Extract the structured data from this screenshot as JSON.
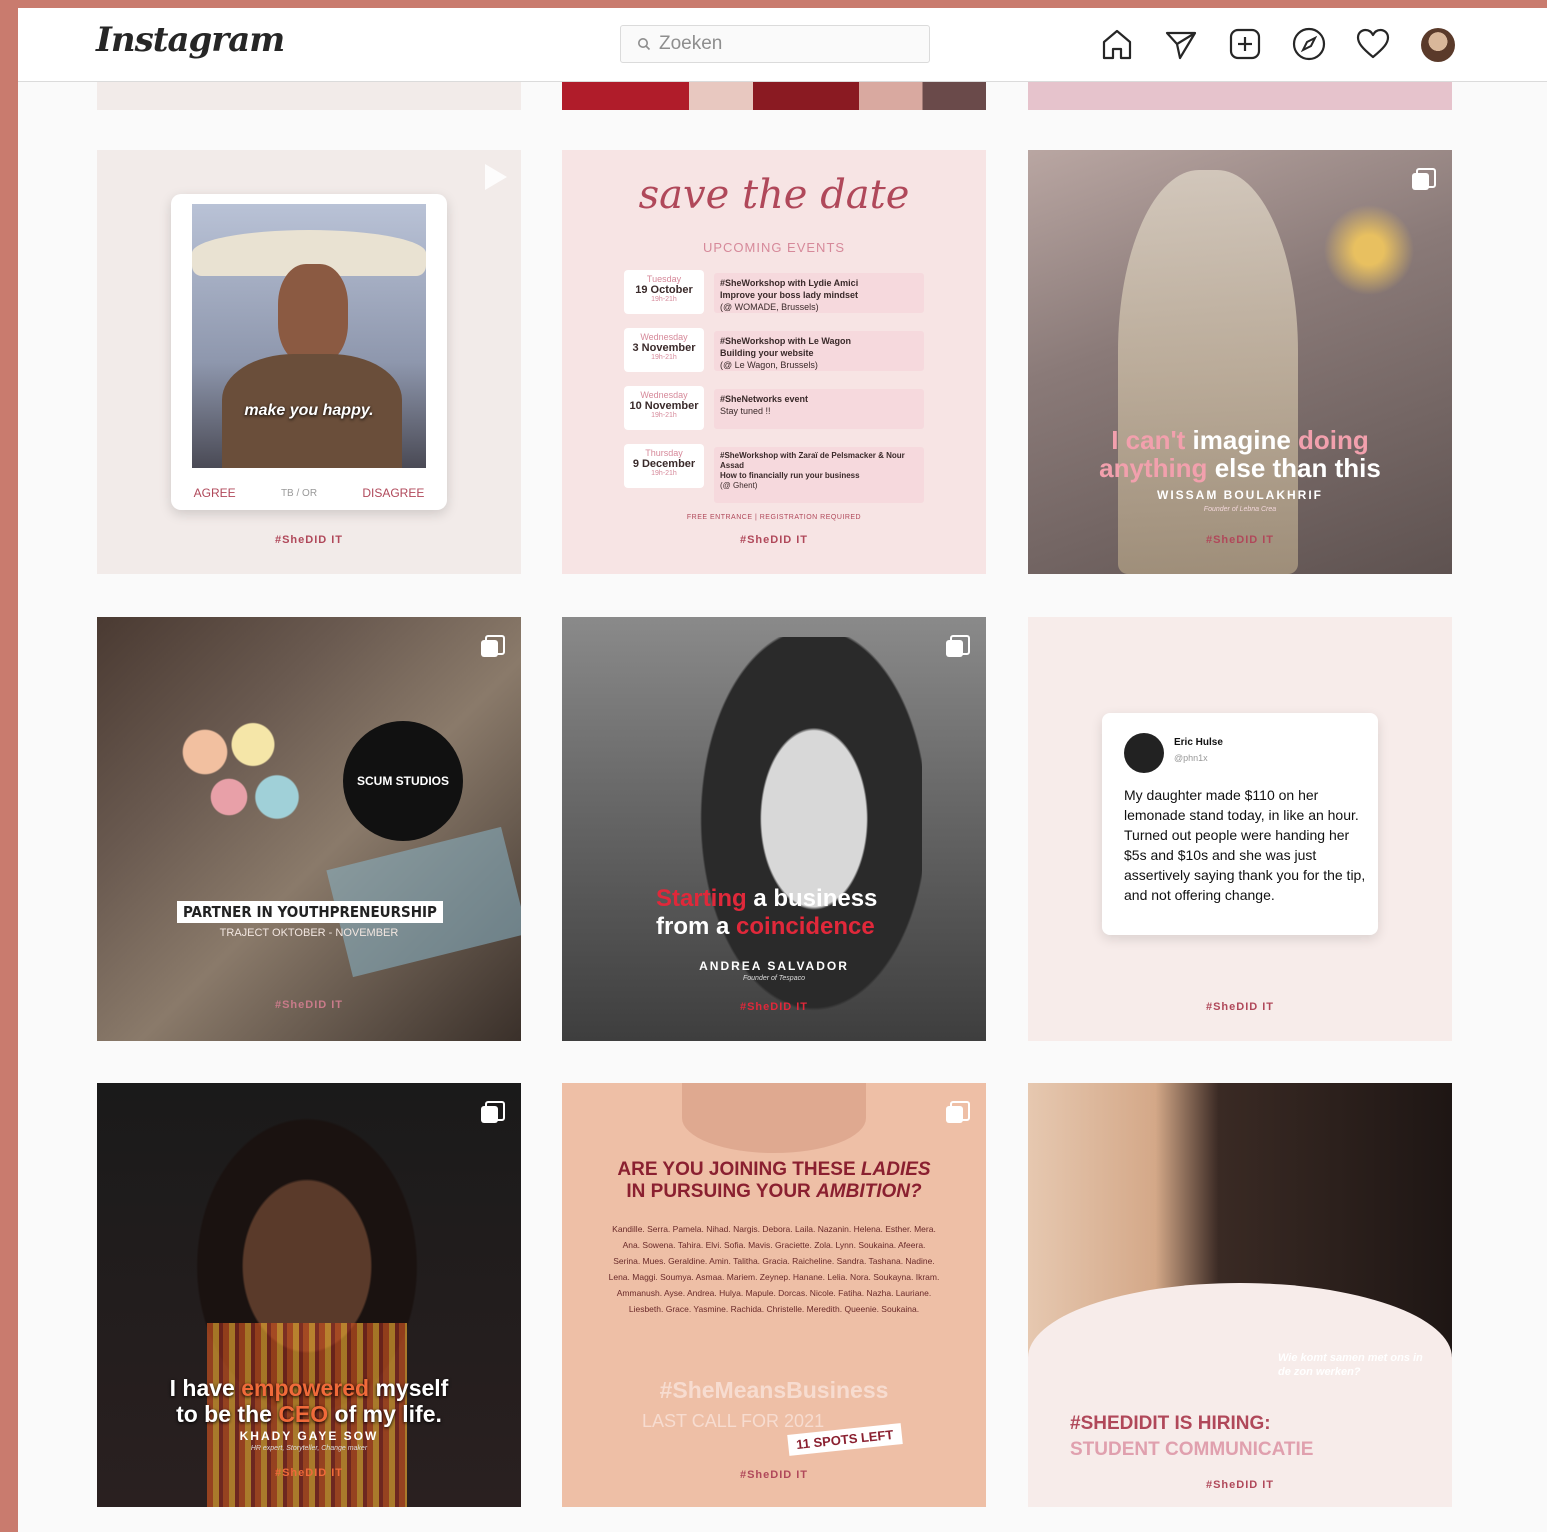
{
  "header": {
    "logo": "Instagram",
    "search_placeholder": "Zoeken"
  },
  "posts": {
    "p1": {
      "caption": "make you happy.",
      "agree": "AGREE",
      "tab": "TB / OR",
      "disagree": "DISAGREE",
      "brand": "#SheDID IT"
    },
    "p2": {
      "script_title": "save the date",
      "subtitle": "UPCOMING EVENTS",
      "events": [
        {
          "day": "Tuesday",
          "date": "19 October",
          "time": "19h-21h",
          "line1": "#SheWorkshop with Lydie Amici",
          "line2": "Improve your boss lady mindset",
          "line3": "(@ WOMADE, Brussels)"
        },
        {
          "day": "Wednesday",
          "date": "3 November",
          "time": "19h-21h",
          "line1": "#SheWorkshop with Le Wagon",
          "line2": "Building your website",
          "line3": "(@ Le Wagon, Brussels)"
        },
        {
          "day": "Wednesday",
          "date": "10 November",
          "time": "19h-21h",
          "line1": "#SheNetworks event",
          "line2": "Stay tuned !!",
          "line3": ""
        },
        {
          "day": "Thursday",
          "date": "9 December",
          "time": "19h-21h",
          "line1": "#SheWorkshop with Zaraï de Pelsmacker & Nour Assad",
          "line2": "How to financially run your business",
          "line3": "(@ Ghent)"
        }
      ],
      "footer": "FREE ENTRANCE | REGISTRATION REQUIRED",
      "brand": "#SheDID IT"
    },
    "p3": {
      "quote_a": "I can't",
      "quote_b": "imagine",
      "quote_c": "doing",
      "quote_d": "anything",
      "quote_e": "else than",
      "quote_f": "this",
      "name": "WISSAM BOULAKHRIF",
      "role": "Founder of Lebna Crea",
      "brand": "#SheDID IT"
    },
    "p4": {
      "title": "PARTNER IN YOUTHPRENEURSHIP",
      "subtitle": "TRAJECT OKTOBER - NOVEMBER",
      "logo_text": "SCUM STUDIOS",
      "brand": "#SheDID IT"
    },
    "p5": {
      "w1": "Starting",
      "w2": "a business",
      "w3": "from a",
      "w4": "coincidence",
      "name": "ANDREA SALVADOR",
      "role": "Founder of Tespaco",
      "brand": "#SheDID IT"
    },
    "p6": {
      "tweet_name": "Eric Hulse",
      "tweet_handle": "@phn1x",
      "tweet_text": "My daughter made $110 on her lemonade stand today, in like an hour. Turned out people were handing her $5s and $10s and she was just assertively saying thank you for the tip, and not offering change.",
      "brand": "#SheDID IT"
    },
    "p7": {
      "q1": "I have",
      "q2": "empowered",
      "q3": "myself",
      "q4": "to be the",
      "q5": "CEO",
      "q6": "of my life.",
      "name": "KHADY GAYE SOW",
      "role": "HR expert, Storyteller, Change maker",
      "brand": "#SheDID IT"
    },
    "p8": {
      "heading1": "ARE YOU JOINING THESE",
      "heading1b": "LADIES",
      "heading2": "IN PURSUING YOUR",
      "heading2b": "AMBITION?",
      "names": "Kandille. Serra. Pamela. Nihad. Nargis. Debora. Laila. Nazanin. Helena. Esther. Mera. Ana. Sowena. Tahira. Elvi. Sofia. Mavis. Graciette. Zola. Lynn. Soukaina. Afeera. Serina. Mues. Geraldine. Amin. Talitha. Gracia. Raicheline. Sandra. Tashana. Nadine. Lena. Maggi. Soumya. Asmaa. Mariem. Zeynep. Hanane. Lelia. Nora. Soukayna. Ikram. Ammanush. Ayse. Andrea. Hulya. Mapule. Dorcas. Nicole. Fatiha. Nazha. Lauriane. Liesbeth. Grace. Yasmine. Rachida. Christelle. Meredith. Queenie. Soukaina.",
      "hashtag": "#SheMeansBusiness",
      "last_call": "LAST CALL FOR 2021",
      "spots": "11 SPOTS LEFT",
      "brand": "#SheDID IT"
    },
    "p9": {
      "bubble": "Wie komt samen met ons in de zon werken?",
      "line1": "#SHEDIDIT IS HIRING:",
      "line2": "STUDENT COMMUNICATIE",
      "brand": "#SheDID IT"
    }
  }
}
